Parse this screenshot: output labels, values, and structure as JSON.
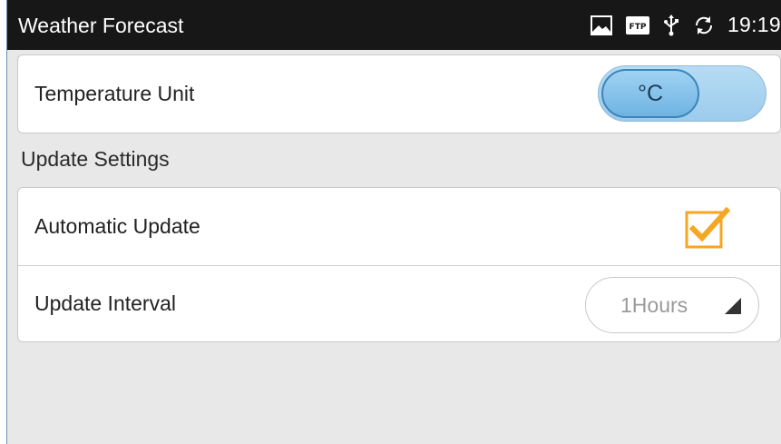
{
  "statusbar": {
    "title": "Weather Forecast",
    "time": "19:19",
    "icons": {
      "image": "image-icon",
      "ftp": "ftp-icon",
      "ftp_text": "FTP",
      "usb": "usb-icon",
      "sync": "sync-icon"
    }
  },
  "temperature": {
    "label": "Temperature Unit",
    "toggle_value": "°C"
  },
  "update_settings": {
    "header": "Update Settings",
    "automatic": {
      "label": "Automatic Update",
      "checked": true
    },
    "interval": {
      "label": "Update Interval",
      "value": "1Hours"
    }
  },
  "colors": {
    "accent_check": "#f5a623",
    "toggle_blue": "#6fb3e3",
    "status_bar": "#171717",
    "background": "#e8e8e8"
  }
}
